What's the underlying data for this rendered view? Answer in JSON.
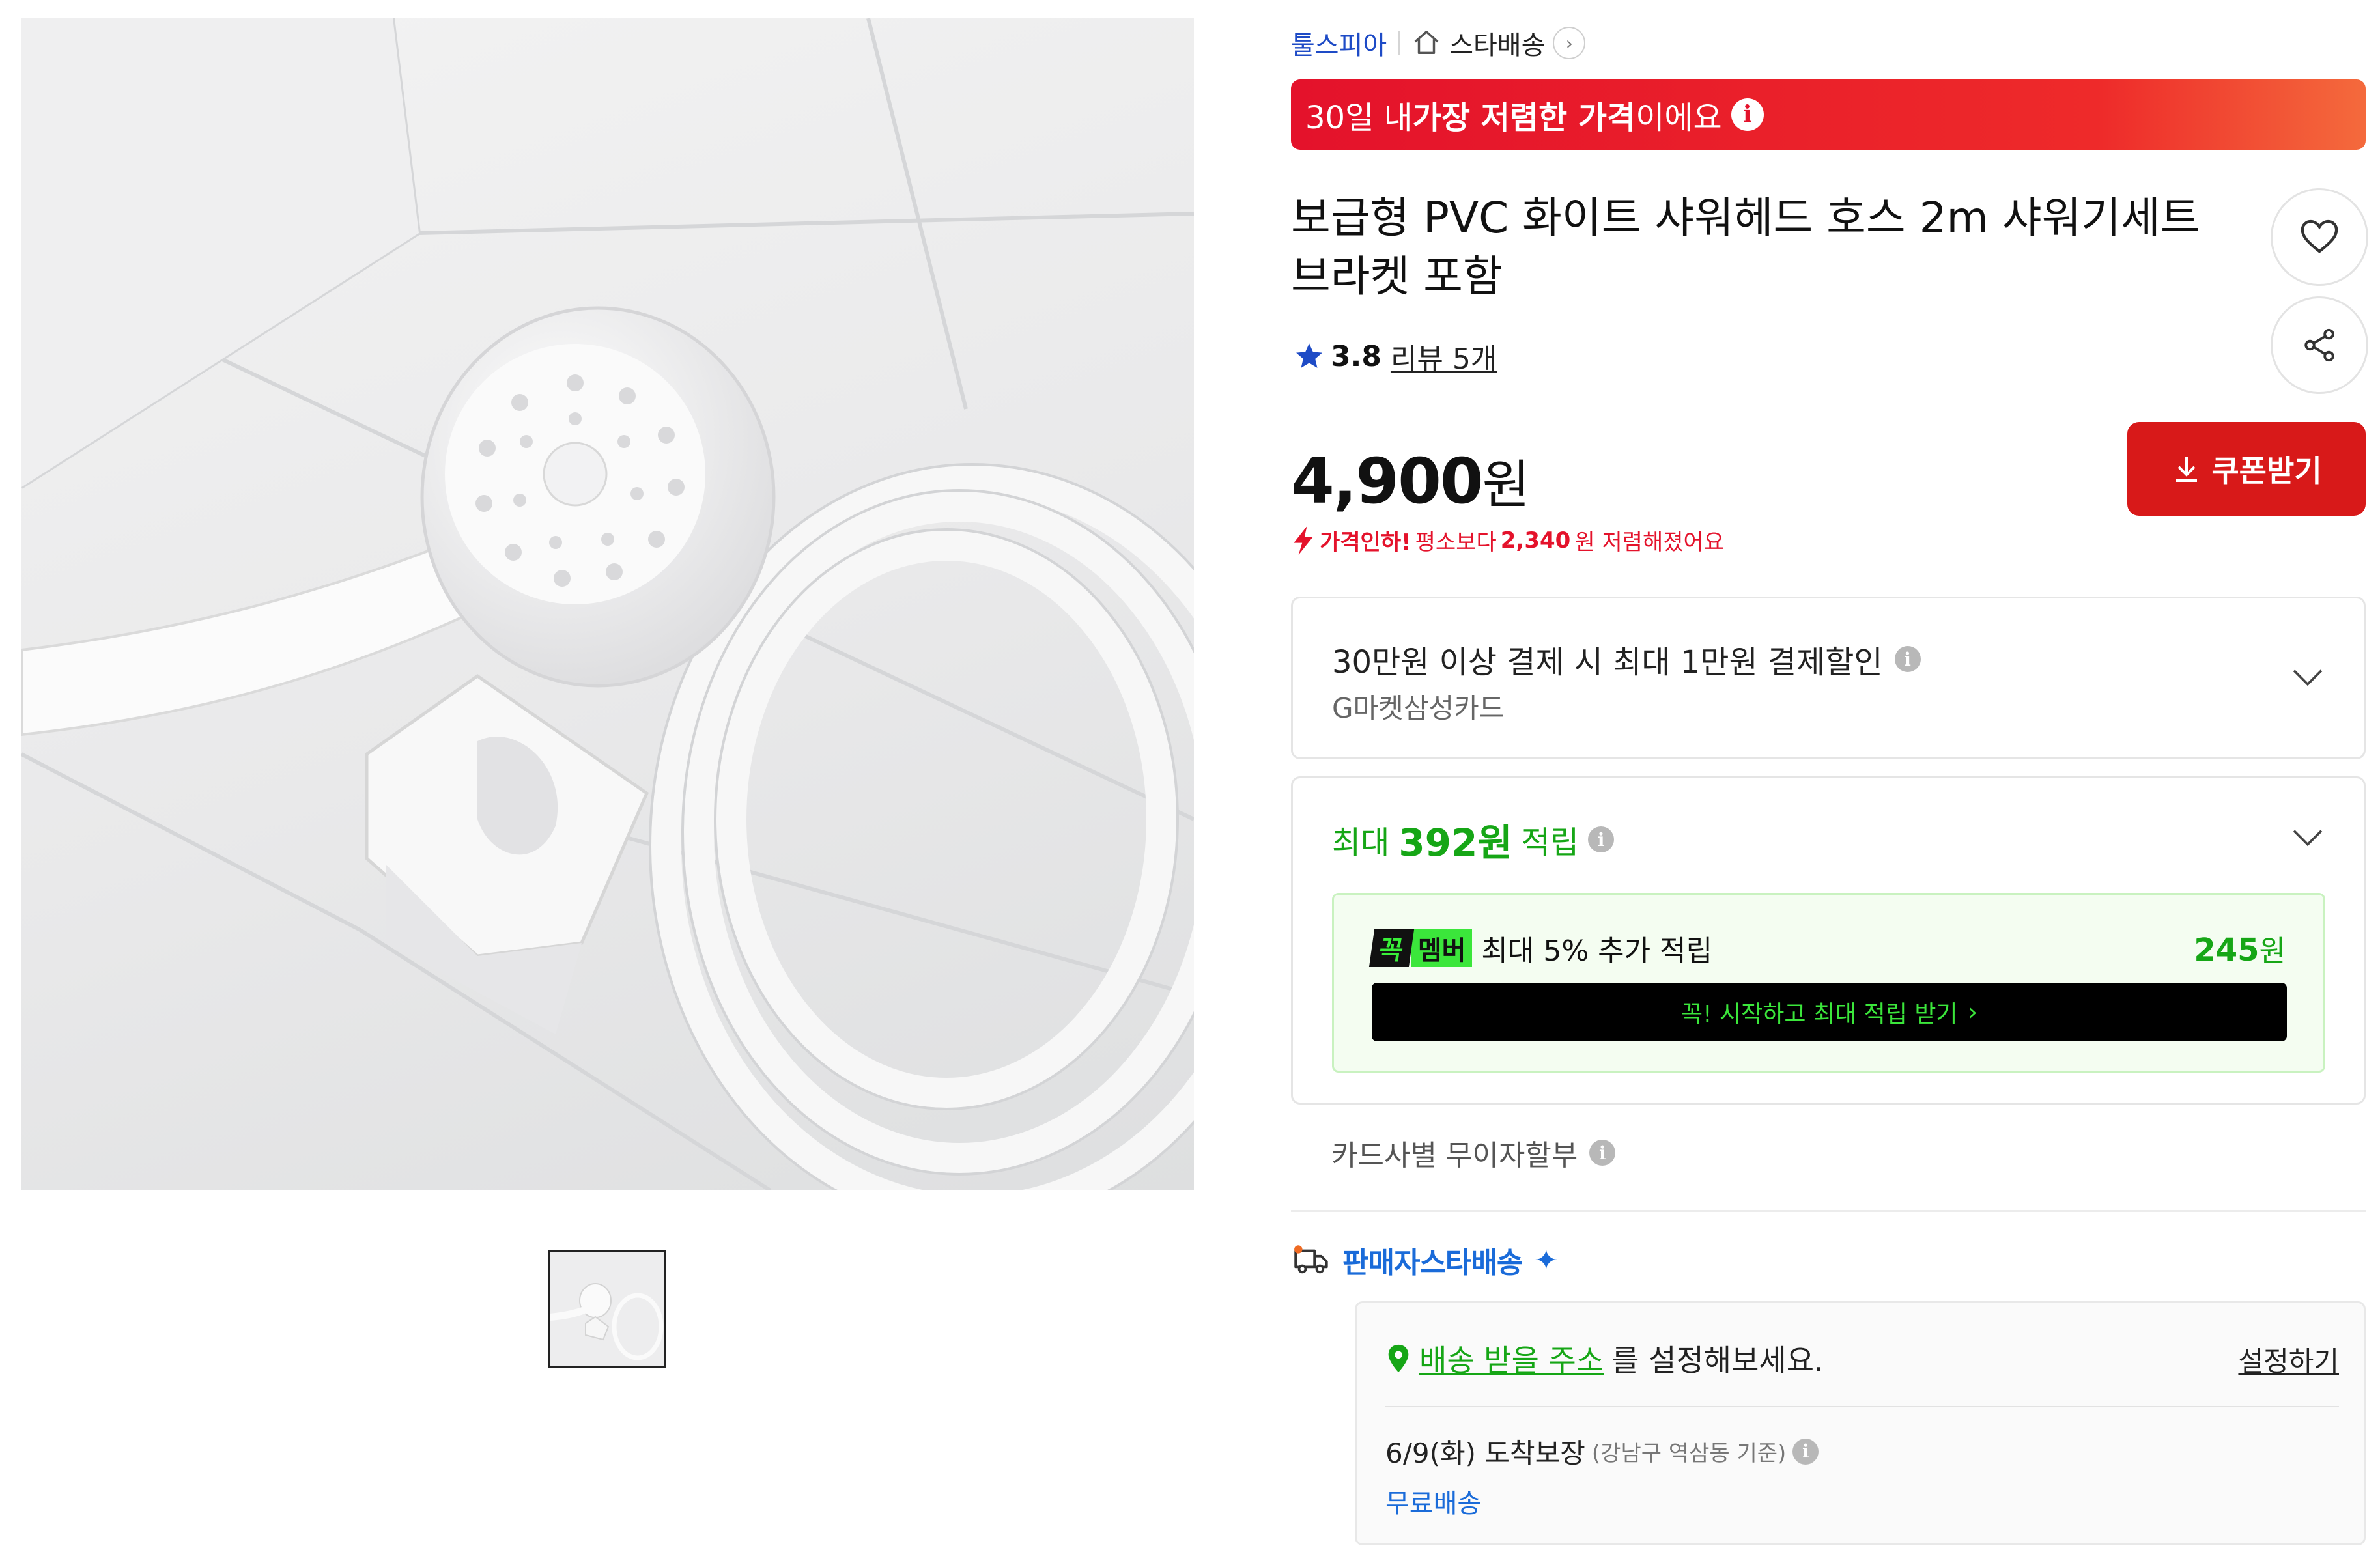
{
  "seller": {
    "name": "툴스피아",
    "delivery_label": "스타배송"
  },
  "banner": {
    "prefix": "30일 내 ",
    "bold": "가장 저렴한 가격",
    "suffix": "이에요"
  },
  "product": {
    "title": "보급형 PVC 화이트 샤워헤드 호스 2m 샤워기세트 브라켓 포함",
    "rating": "3.8",
    "reviews": "리뷰 5개",
    "price_number": "4,900",
    "price_unit": "원"
  },
  "price_drop": {
    "bold_prefix": "가격인하!",
    "middle": " 평소보다 ",
    "amount": "2,340",
    "suffix": "원 저렴해졌어요"
  },
  "coupon_button": "쿠폰받기",
  "discount_card": {
    "title": "30만원 이상 결제 시 최대 1만원 결제할인",
    "subtitle": "G마켓삼성카드"
  },
  "points_card": {
    "prefix": "최대 ",
    "amount": "392원",
    "suffix": " 적립",
    "member_badge_left": "꼭",
    "member_badge_right": "멤버",
    "member_text": "최대 5% 추가 적립",
    "member_amount": "245",
    "member_amount_unit": "원",
    "cta": "꼭! 시작하고 최대 적립 받기"
  },
  "installment": "카드사별 무이자할부",
  "delivery": {
    "brand": "판매자스타배송",
    "address_link": "배송 받을 주소",
    "address_suffix": " 를 설정해보세요.",
    "set_link": "설정하기",
    "arrival": "6/9(화) 도착보장",
    "arrival_basis": "(강남구 역삼동 기준)",
    "fee": "무료배송"
  },
  "colors": {
    "brand_red": "#e4122b",
    "points_green": "#16a616",
    "link_blue": "#1e4bc6",
    "coupon_red": "#d81919"
  },
  "icons": [
    "home-icon",
    "chevron-right-icon",
    "info-icon",
    "heart-icon",
    "share-icon",
    "star-icon",
    "download-icon",
    "chevron-down-icon",
    "truck-icon",
    "location-pin-icon",
    "lightning-icon"
  ]
}
